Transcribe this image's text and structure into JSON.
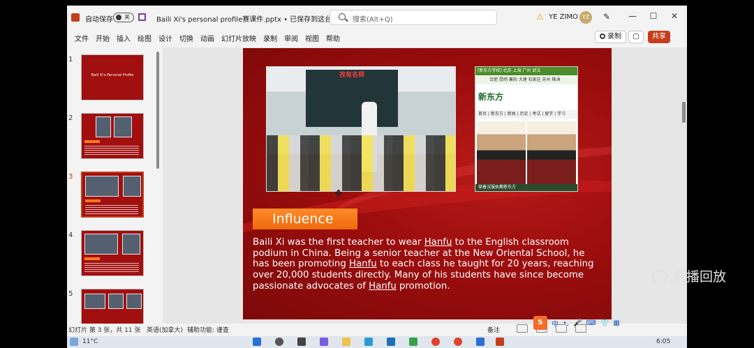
{
  "titlebar": {
    "autosave_label": "自动保存",
    "autosave_state": "关",
    "doc_title": "Baili Xi's personal profile赛课件.pptx • 已保存到这台电脑 ⌄",
    "search_placeholder": "搜索(Alt+Q)",
    "user_name": "YE ZIMO",
    "user_initials": "YZ",
    "minimize": "—",
    "maximize": "☐",
    "close": "✕"
  },
  "menubar": {
    "tabs": [
      "文件",
      "开始",
      "插入",
      "绘图",
      "设计",
      "切换",
      "动画",
      "幻灯片放映",
      "录制",
      "审阅",
      "视图",
      "帮助"
    ],
    "record_label": "录制",
    "share_label": "共享"
  },
  "thumbnails": [
    {
      "number": "1",
      "title": "Baili Xi's Personal Profile"
    },
    {
      "number": "2"
    },
    {
      "number": "3"
    },
    {
      "number": "4"
    },
    {
      "number": "5"
    }
  ],
  "slide": {
    "classroom_banner": "孜有名师",
    "web_nav": "[新东方学校]  北京  上海  广州  武汉",
    "web_nav2": "合肥  昆明  襄阳  大理  石家庄  苏州  株洲",
    "web_logo": "新东方",
    "web_menu": "首页 | 新东方 | 新闻 | 历史 | 考试 | 留学 | 学习",
    "web_caption": "穿着汉服执教新东方",
    "influence_label": "Influence",
    "body_parts": [
      "Baili Xi was the first teacher to wear ",
      "Hanfu",
      " to the English classroom podium in China. Being a senior teacher at the New Oriental School, he has been promoting ",
      "Hanfu",
      " to each class he taught for 20 years, reaching over 20,000 students directly. Many of his students have since become passionate advocates of ",
      "Hanfu",
      " promotion."
    ]
  },
  "watermark": "直播回放",
  "statusbar": {
    "slide_count": "幻灯片 第 3 张，共 11 张",
    "language": "英语(加拿大)",
    "accessibility": "辅助功能: 谨查",
    "notes": "备注"
  },
  "ime": {
    "sogou": "S",
    "lang": "中"
  },
  "taskbar": {
    "weather": "11°C",
    "clock": "6:05"
  },
  "colors": {
    "slide_red": "#9c0d0d",
    "accent_orange": "#ef6a0c",
    "office_red": "#c43e1c"
  }
}
